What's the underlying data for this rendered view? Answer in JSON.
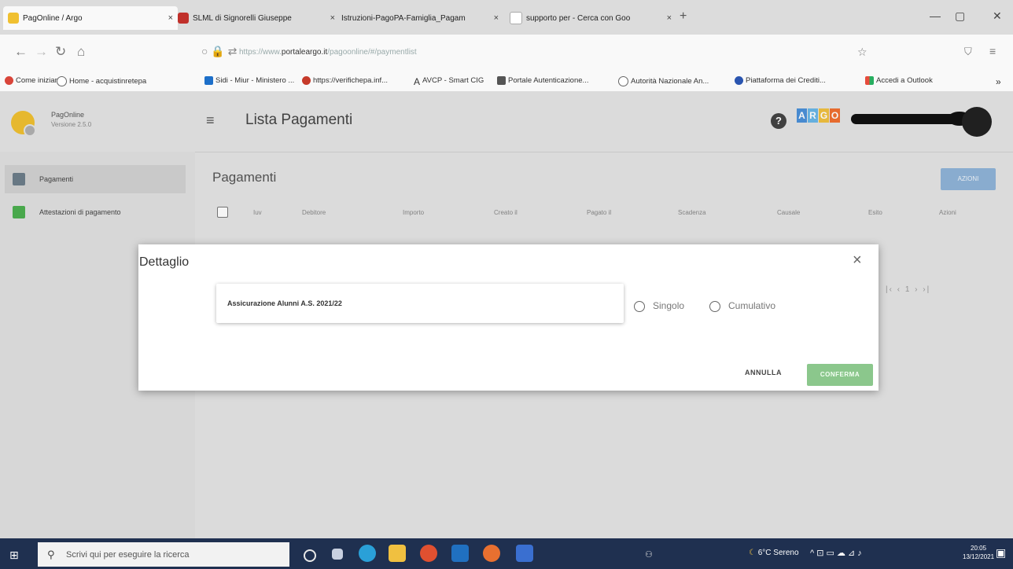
{
  "browser": {
    "tabs": [
      {
        "title": "PagOnline / Argo",
        "close": "×",
        "icon_color": "#f0c030"
      },
      {
        "title": "SLML di Signorelli Giuseppe",
        "close": "×",
        "icon_color": "#c0302a"
      },
      {
        "title": "Istruzioni-PagoPA-Famiglia_Pagam",
        "close": "×",
        "icon_color": "#2b67c9"
      },
      {
        "title": "supporto per - Cerca con Goo",
        "close": "×",
        "icon_color": "#4285f4"
      }
    ],
    "new_tab": "+",
    "window_buttons": {
      "minimize": "—",
      "maximize": "▢",
      "close": "✕"
    },
    "nav": {
      "back": "←",
      "forward": "→",
      "reload": "↻",
      "home": "⌂",
      "star": "☆",
      "shield": "⛉",
      "menu": "≡"
    },
    "url": {
      "prefix": "https://www.",
      "domain": "portaleargo.it",
      "path": "/pagoonline/#/paymentlist"
    },
    "bookmarks": [
      {
        "label": "Come iniziare",
        "color": "#d9453a"
      },
      {
        "label": "Home - acquistinretepa",
        "color": "#666666"
      },
      {
        "label": "Sidi - Miur - Ministero ...",
        "color": "#1d6fc9"
      },
      {
        "label": "https://verifichepa.inf...",
        "color": "#c63a2a"
      },
      {
        "label": "AVCP - Smart CIG",
        "color": "#333333"
      },
      {
        "label": "Portale Autenticazione...",
        "color": "#555555"
      },
      {
        "label": "Autorità Nazionale An...",
        "color": "#666666"
      },
      {
        "label": "Piattaforma dei Crediti...",
        "color": "#2a55b0"
      },
      {
        "label": "Accedi a Outlook",
        "color": "#e07020"
      }
    ],
    "more_bookmarks": "»"
  },
  "app": {
    "name": "PagOnline",
    "version": "Versione 2.5.0",
    "page_title": "Lista Pagamenti",
    "help": "?",
    "brand_letters": [
      {
        "letter": "A",
        "color": "#4a90d9"
      },
      {
        "letter": "R",
        "color": "#6ab7e8"
      },
      {
        "letter": "G",
        "color": "#f0c040"
      },
      {
        "letter": "O",
        "color": "#f07030"
      }
    ],
    "sidebar": [
      {
        "label": "Pagamenti",
        "color": "#6d7d8a",
        "active": true
      },
      {
        "label": "Attestazioni di pagamento",
        "color": "#4caf50",
        "active": false
      }
    ],
    "section_title": "Pagamenti",
    "azioni_button": "AZIONI",
    "columns": [
      "Iuv",
      "Debitore",
      "Importo",
      "Creato il",
      "Pagato il",
      "Scadenza",
      "Causale",
      "Esito",
      "Azioni"
    ],
    "pagination": "|‹  ‹  1  ›  ›|"
  },
  "dialog": {
    "title": "Dettaglio",
    "close": "×",
    "item": "Assicurazione Alunni A.S. 2021/22",
    "options": [
      "Singolo",
      "Cumulativo"
    ],
    "cancel": "ANNULLA",
    "confirm": "CONFERMA"
  },
  "taskbar": {
    "start": "⊞",
    "search_icon": "⚲",
    "search_placeholder": "Scrivi qui per eseguire la ricerca",
    "apps": [
      {
        "name": "cortana",
        "color": "#e8e8e8"
      },
      {
        "name": "task-view",
        "color": "#c8d0e0"
      },
      {
        "name": "edge",
        "color": "#2aa0d8"
      },
      {
        "name": "store",
        "color": "#f0c040"
      },
      {
        "name": "chrome",
        "color": "#e05030"
      },
      {
        "name": "files",
        "color": "#2070c0"
      },
      {
        "name": "firefox",
        "color": "#e87030"
      },
      {
        "name": "word",
        "color": "#3a6fd0"
      }
    ],
    "weather": "6°C Sereno",
    "system": "^  ⊡  ▭  ☁  ⊿  ♪",
    "time": "20:05",
    "date": "13/12/2021",
    "notifications": "▣"
  }
}
